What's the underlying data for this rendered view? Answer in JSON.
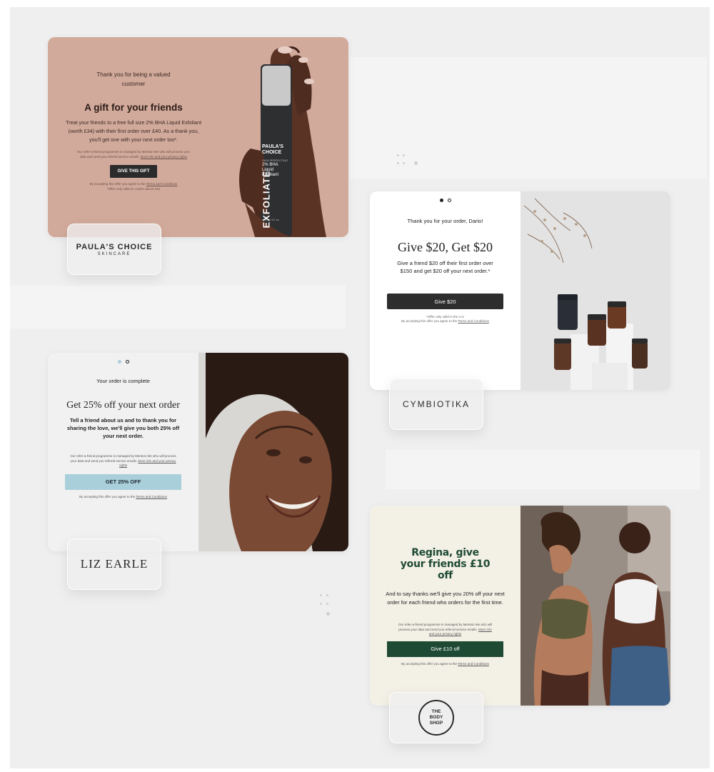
{
  "paulas": {
    "thanks": "Thank you for being a valued customer",
    "heading": "A gift for your friends",
    "body": "Treat your friends to a free full size 2% BHA Liquid Exfoliant (worth £34) with their first order over £40. As a thank you, you'll get one with your next order too*.",
    "fine1": "Our refer-a-friend programme is managed by Mention Me who will process your data and send you referral service emails.",
    "fine_link": "More info and your privacy rights",
    "button": "GIVE THIS GIFT",
    "accept_text": "By accepting this offer you agree to the",
    "accept_link": "Terms and Conditions",
    "offer_note": "*Offer only valid on orders above £40",
    "bottle": {
      "brand": "PAULA'S CHOICE",
      "line": "SKIN PERFECTING",
      "product": "2% BHA Liquid Exfoliant",
      "vertical": "EXFOLIATE",
      "size": "118 ml / 4 fl. oz."
    },
    "logo_name": "PAULA'S CHOICE",
    "logo_sub": "SKINCARE"
  },
  "cymbiotika": {
    "thanks": "Thank you for your order, Dario!",
    "heading": "Give $20, Get $20",
    "body": "Give a friend $20 off their first order over $150 and get $20 off your next order.*",
    "button": "Give $20",
    "offer_note": "*Offer only valid in the U.S",
    "accept_text": "By accepting this offer you agree to the",
    "accept_link": "Terms and Conditions",
    "logo": "CYMBIOTIKA"
  },
  "lizearle": {
    "status": "Your order is complete",
    "heading": "Get 25% off your next order",
    "body": "Tell a friend about us and to thank you for sharing the love, we'll give you both 25% off your next order.",
    "fine1": "Our refer-a-friend programme is managed by Mention Me who will process your data and send you referral service emails.",
    "fine_link": "More info and your privacy rights",
    "button": "GET 25% OFF",
    "accept_text": "By accepting this offer you agree to the",
    "accept_link": "Terms and Conditions",
    "logo": "LIZ EARLE"
  },
  "bodyshop": {
    "heading": "Regina, give your friends £10 off",
    "body": "And to say thanks we'll give you 20% off your next order for each friend who orders for the first time.",
    "fine1": "Our refer-a-friend programme is managed by Mention Me who will process your data and send you referral service emails.",
    "fine_link": "More info and your privacy rights",
    "button": "Give £10 off",
    "accept_text": "By accepting this offer you agree to the",
    "accept_link": "Terms and Conditions",
    "logo_1": "THE",
    "logo_2": "BODY",
    "logo_3": "SHOP"
  },
  "colors": {
    "paulas_bg": "#d2aa9b",
    "liz_button": "#a9cfdb",
    "bodyshop_button": "#1e4a33",
    "bodyshop_bg": "#f3f0e6",
    "dark_button": "#2d2d2d"
  }
}
